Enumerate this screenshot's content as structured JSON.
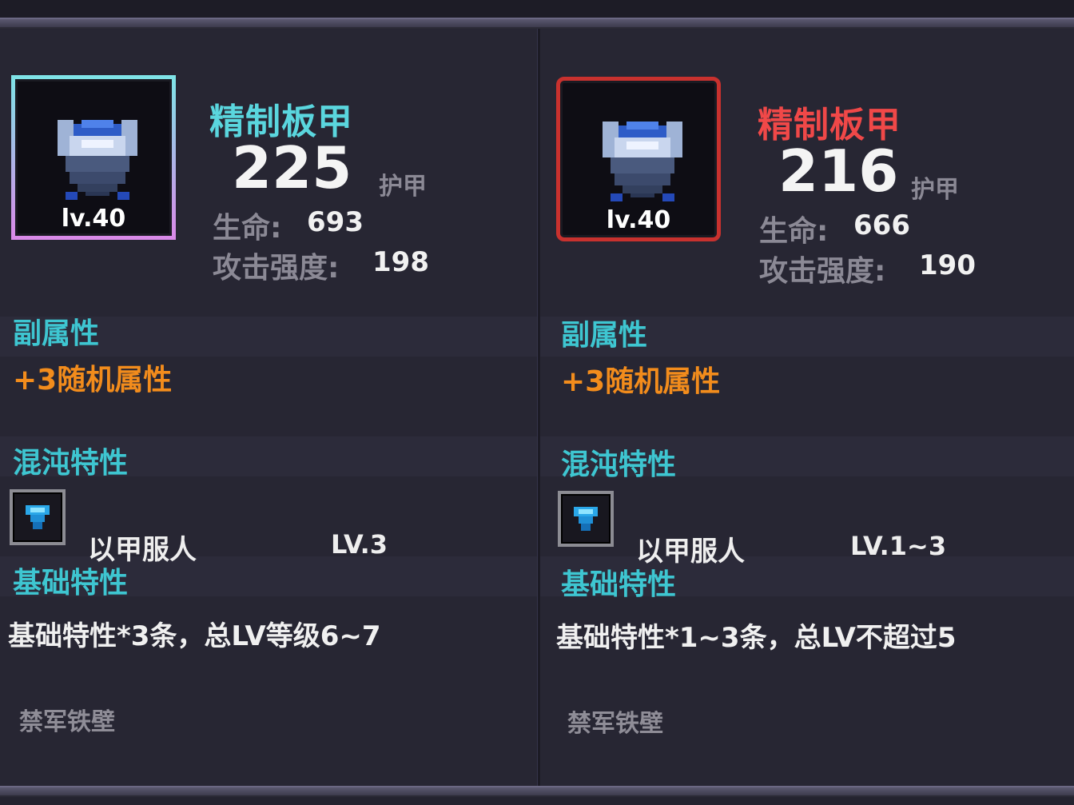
{
  "header_text": "",
  "items": [
    {
      "name": "精制板甲",
      "name_color": "#5ad6de",
      "frame": "purple",
      "level": "lv.40",
      "armor_value": "225",
      "armor_label": "护甲",
      "stats": [
        {
          "label": "生命:",
          "value": "693"
        },
        {
          "label": "攻击强度:",
          "value": "198"
        }
      ],
      "secondary_title": "副属性",
      "secondary_value": "+3随机属性",
      "chaos_title": "混沌特性",
      "chaos_trait": {
        "icon": "blue-gem-icon",
        "name": "以甲服人",
        "level": "LV.3"
      },
      "base_title": "基础特性",
      "base_desc": "基础特性*3条，总LV等级6~7",
      "set_name": "禁军铁壁"
    },
    {
      "name": "精制板甲",
      "name_color": "#f04848",
      "frame": "red",
      "level": "lv.40",
      "armor_value": "216",
      "armor_label": "护甲",
      "stats": [
        {
          "label": "生命:",
          "value": "666"
        },
        {
          "label": "攻击强度:",
          "value": "190"
        }
      ],
      "secondary_title": "副属性",
      "secondary_value": "+3随机属性",
      "chaos_title": "混沌特性",
      "chaos_trait": {
        "icon": "blue-gem-icon",
        "name": "以甲服人",
        "level": "LV.1~3"
      },
      "base_title": "基础特性",
      "base_desc": "基础特性*1~3条，总LV不超过5",
      "set_name": "禁军铁壁"
    }
  ]
}
